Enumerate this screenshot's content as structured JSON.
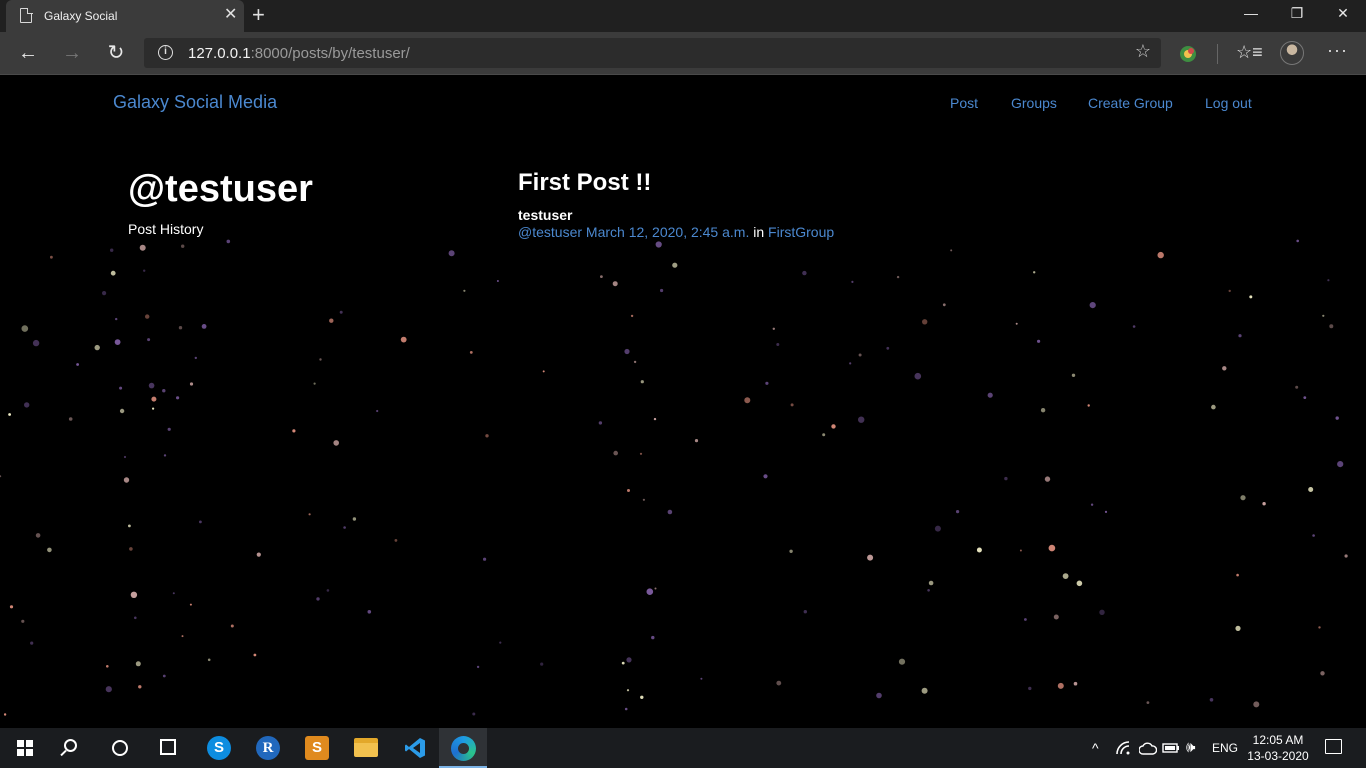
{
  "browser": {
    "tab_title": "Galaxy Social",
    "tab_close": "✕",
    "new_tab": "+",
    "url_host": "127.0.0.1",
    "url_rest": ":8000/posts/by/testuser/",
    "window_controls": {
      "minimize": "—",
      "restore": "❐",
      "close": "✕"
    },
    "nav": {
      "back": "←",
      "forward": "→",
      "refresh": "↻"
    },
    "icons": {
      "star": "☆",
      "favorites": "☆≡",
      "more": "···",
      "info": "i"
    }
  },
  "site": {
    "brand": "Galaxy Social Media",
    "nav": [
      "Post",
      "Groups",
      "Create Group",
      "Log out"
    ]
  },
  "profile": {
    "handle": "@testuser",
    "subtitle": "Post History"
  },
  "post": {
    "title": "First Post !!",
    "author": "testuser",
    "handle": "@testuser",
    "timestamp": "March 12, 2020, 2:45 a.m.",
    "in_word": "in",
    "group": "FirstGroup"
  },
  "colors": {
    "link": "#4b88cf",
    "background": "#000000",
    "star_tones": [
      "#f4f1c9",
      "#d98b7a",
      "#7a5a9c",
      "#c9a2a0",
      "#6a4e8a"
    ]
  },
  "taskbar": {
    "apps": [
      "start-icon",
      "search-icon",
      "cortana-icon",
      "task-view-icon",
      "skype-icon",
      "r-icon",
      "sublime-icon",
      "file-explorer-icon",
      "vscode-icon",
      "edge-icon"
    ],
    "skype_letter": "S",
    "r_letter": "R",
    "sublime_letter": "S",
    "tray": {
      "chevron": "^",
      "lang": "ENG",
      "volume": "🕪"
    },
    "time": "12:05 AM",
    "date": "13-03-2020"
  }
}
